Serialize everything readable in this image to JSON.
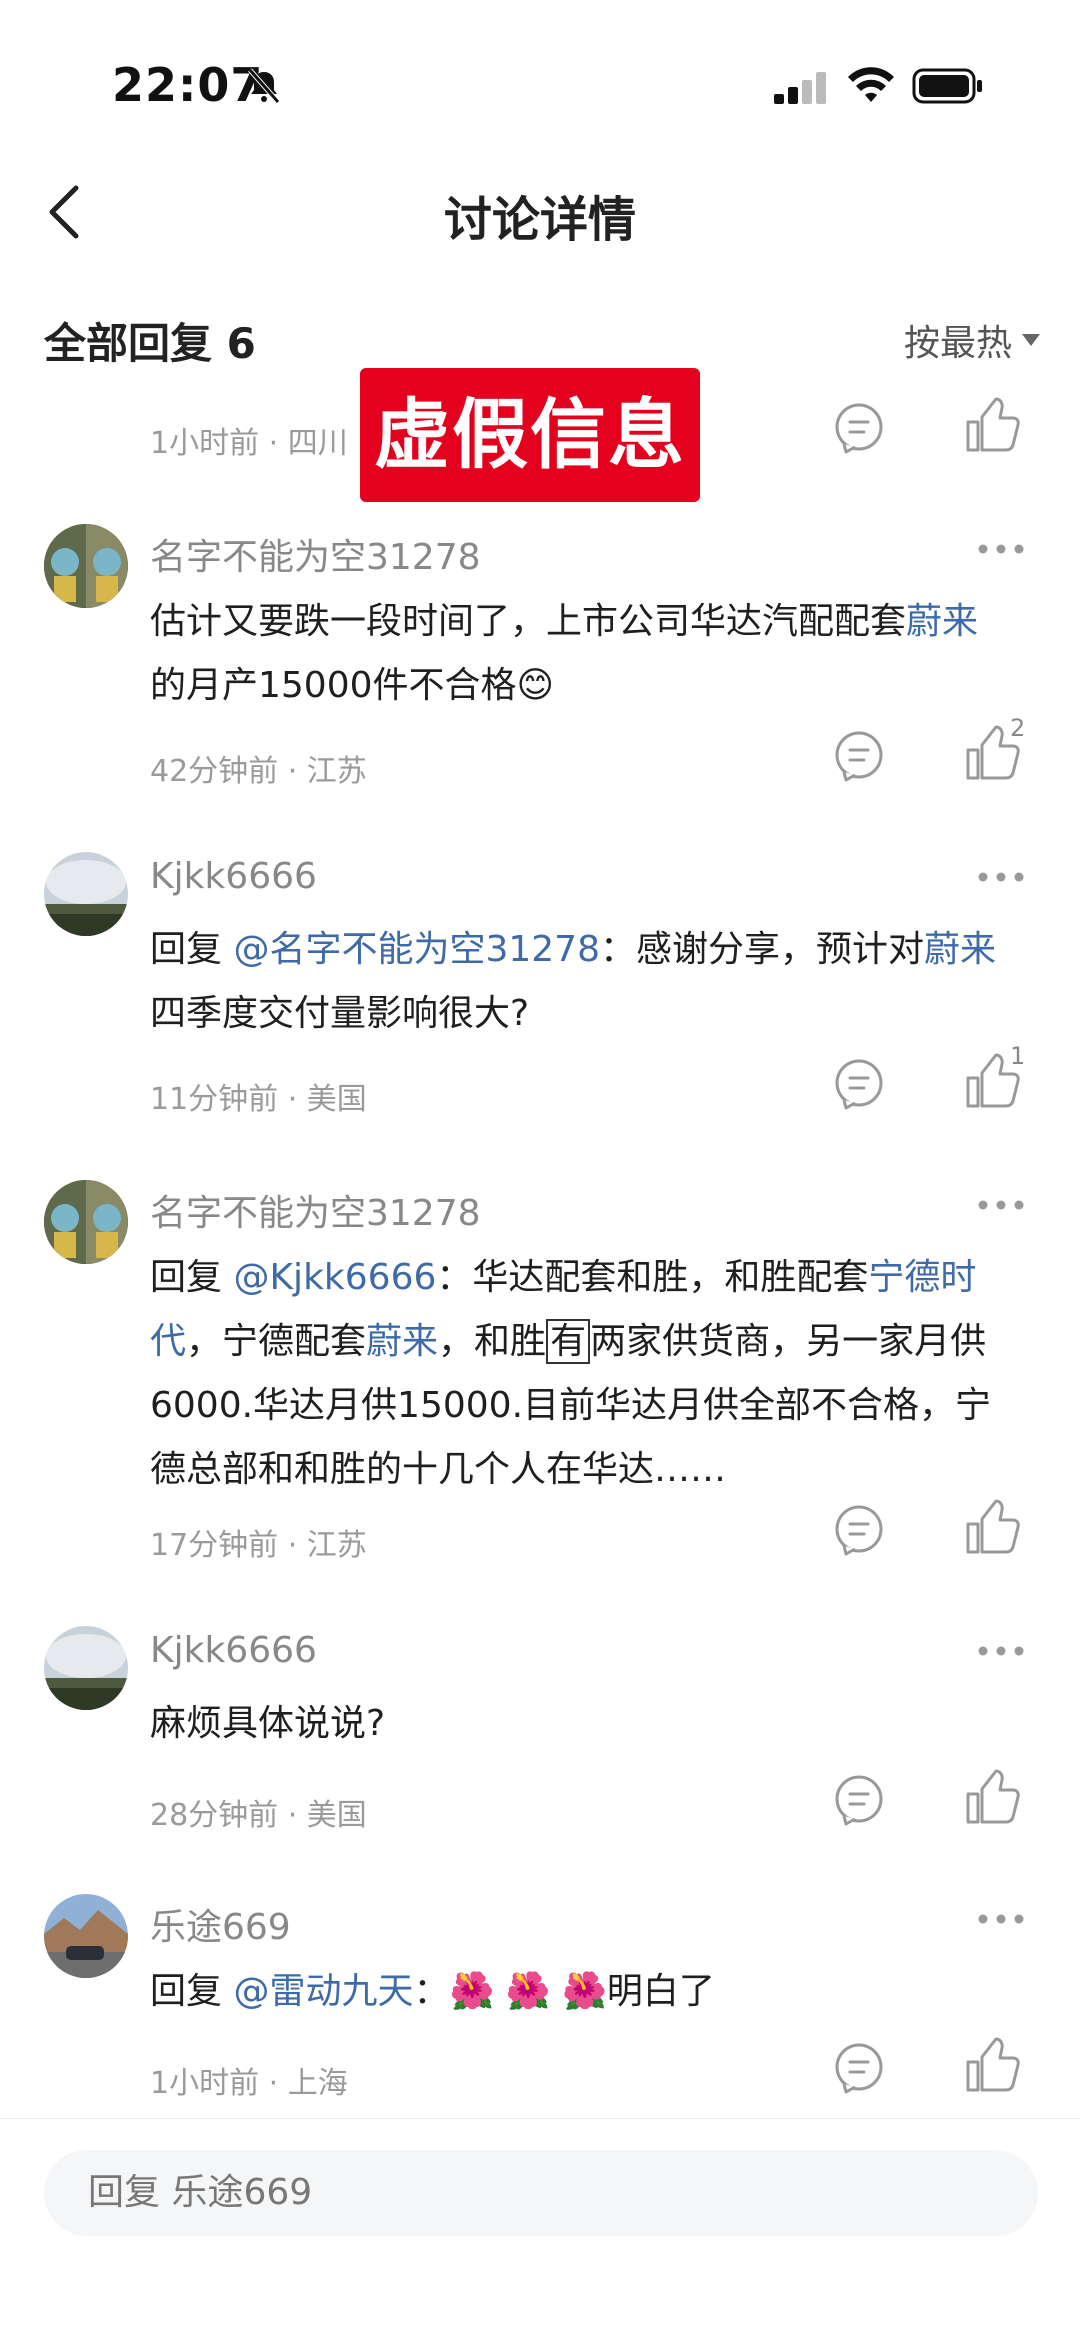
{
  "status_bar": {
    "time": "22:07"
  },
  "nav": {
    "title": "讨论详情"
  },
  "replies": {
    "header": "全部回复 6",
    "sort_label": "按最热"
  },
  "stamp": {
    "text": "虚假信息"
  },
  "partial_comment": {
    "time": "1小时前",
    "location": "四川"
  },
  "comments": [
    {
      "username": "名字不能为空31278",
      "text_line1_pre": "估计又要跌一段时间了，上市公司华达汽配配套",
      "text_line1_link": "蔚来",
      "text_line2": "的月产15000件不合格",
      "emoji": "😊",
      "time": "42分钟前",
      "location": "江苏",
      "likes": "2"
    },
    {
      "username": "Kjkk6666",
      "reply_prefix": "回复 ",
      "mention": "@名字不能为空31278",
      "text_line1_mid": "：感谢分享，预计对",
      "text_line1_link": "蔚来",
      "text_line2": "四季度交付量影响很大?",
      "time": "11分钟前",
      "location": "美国",
      "likes": "1"
    },
    {
      "username": "名字不能为空31278",
      "reply_prefix": "回复 ",
      "mention": "@Kjkk6666",
      "l1_mid": "：华达配套和胜，和胜配套",
      "l1_link": "宁德时",
      "l2_link_a": "代",
      "l2_mid_a": "，宁德配套",
      "l2_link_b": "蔚来",
      "l2_mid_b": "，和胜",
      "l2_boxed": "有",
      "l2_tail": "两家供货商，另一家月供",
      "line3": "6000.华达月供15000.目前华达月供全部不合格，宁",
      "line4": "德总部和和胜的十几个人在华达……",
      "time": "17分钟前",
      "location": "江苏"
    },
    {
      "username": "Kjkk6666",
      "text": "麻烦具体说说?",
      "time": "28分钟前",
      "location": "美国"
    },
    {
      "username": "乐途669",
      "reply_prefix": "回复 ",
      "mention": "@雷动九天",
      "colon": "：",
      "flowers": "🌺 🌺 🌺",
      "tail": "明白了",
      "time": "1小时前",
      "location": "上海"
    }
  ],
  "bottom_input": {
    "placeholder": "回复 乐途669"
  },
  "meta_sep": " · ",
  "colors": {
    "accent_link": "#3e6aa8",
    "stamp_red": "#e3011e",
    "meta_gray": "#9a9a9a"
  },
  "icons": [
    "bell-slash-icon",
    "signal-icon",
    "wifi-icon",
    "battery-icon",
    "back-arrow-icon",
    "reply-icon",
    "thumbs-up-icon",
    "more-dots-icon",
    "caret-down-icon"
  ]
}
